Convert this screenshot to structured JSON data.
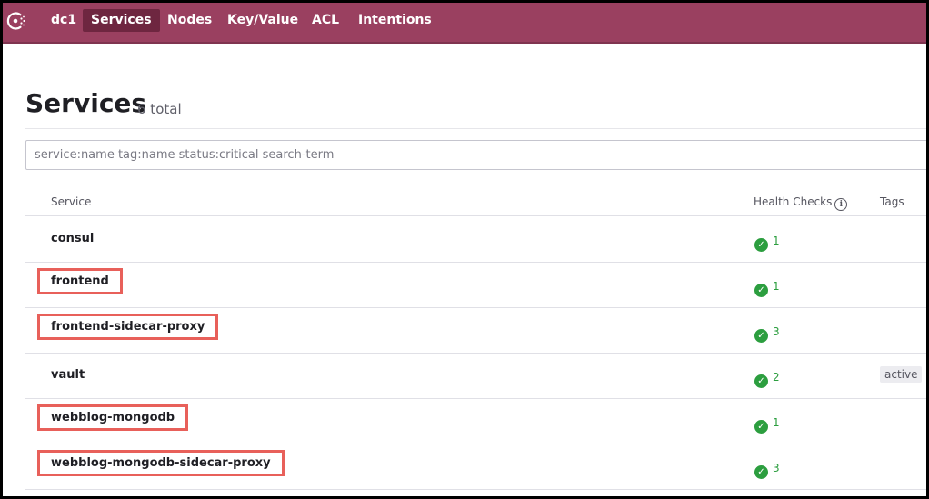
{
  "nav": {
    "datacenter": "dc1",
    "items": [
      "Services",
      "Nodes",
      "Key/Value",
      "ACL",
      "Intentions"
    ],
    "active": "Services"
  },
  "page": {
    "title": "Services",
    "count": "6 total"
  },
  "search": {
    "placeholder": "service:name tag:name status:critical search-term"
  },
  "table": {
    "headers": {
      "service": "Service",
      "health": "Health Checks",
      "tags": "Tags"
    },
    "rows": [
      {
        "name": "consul",
        "checks": "1",
        "tag": "",
        "highlighted": false
      },
      {
        "name": "frontend",
        "checks": "1",
        "tag": "",
        "highlighted": true
      },
      {
        "name": "frontend-sidecar-proxy",
        "checks": "3",
        "tag": "",
        "highlighted": true
      },
      {
        "name": "vault",
        "checks": "2",
        "tag": "active",
        "highlighted": false
      },
      {
        "name": "webblog-mongodb",
        "checks": "1",
        "tag": "",
        "highlighted": true
      },
      {
        "name": "webblog-mongodb-sidecar-proxy",
        "checks": "3",
        "tag": "",
        "highlighted": true
      }
    ]
  },
  "colors": {
    "nav_bg": "#9a4060",
    "nav_active": "#6e2640",
    "passing": "#2c9e3f",
    "highlight_box": "#e8605a"
  },
  "icons": {
    "logo": "consul-logo-icon",
    "info": "info-icon",
    "passing": "check-circle-icon"
  }
}
